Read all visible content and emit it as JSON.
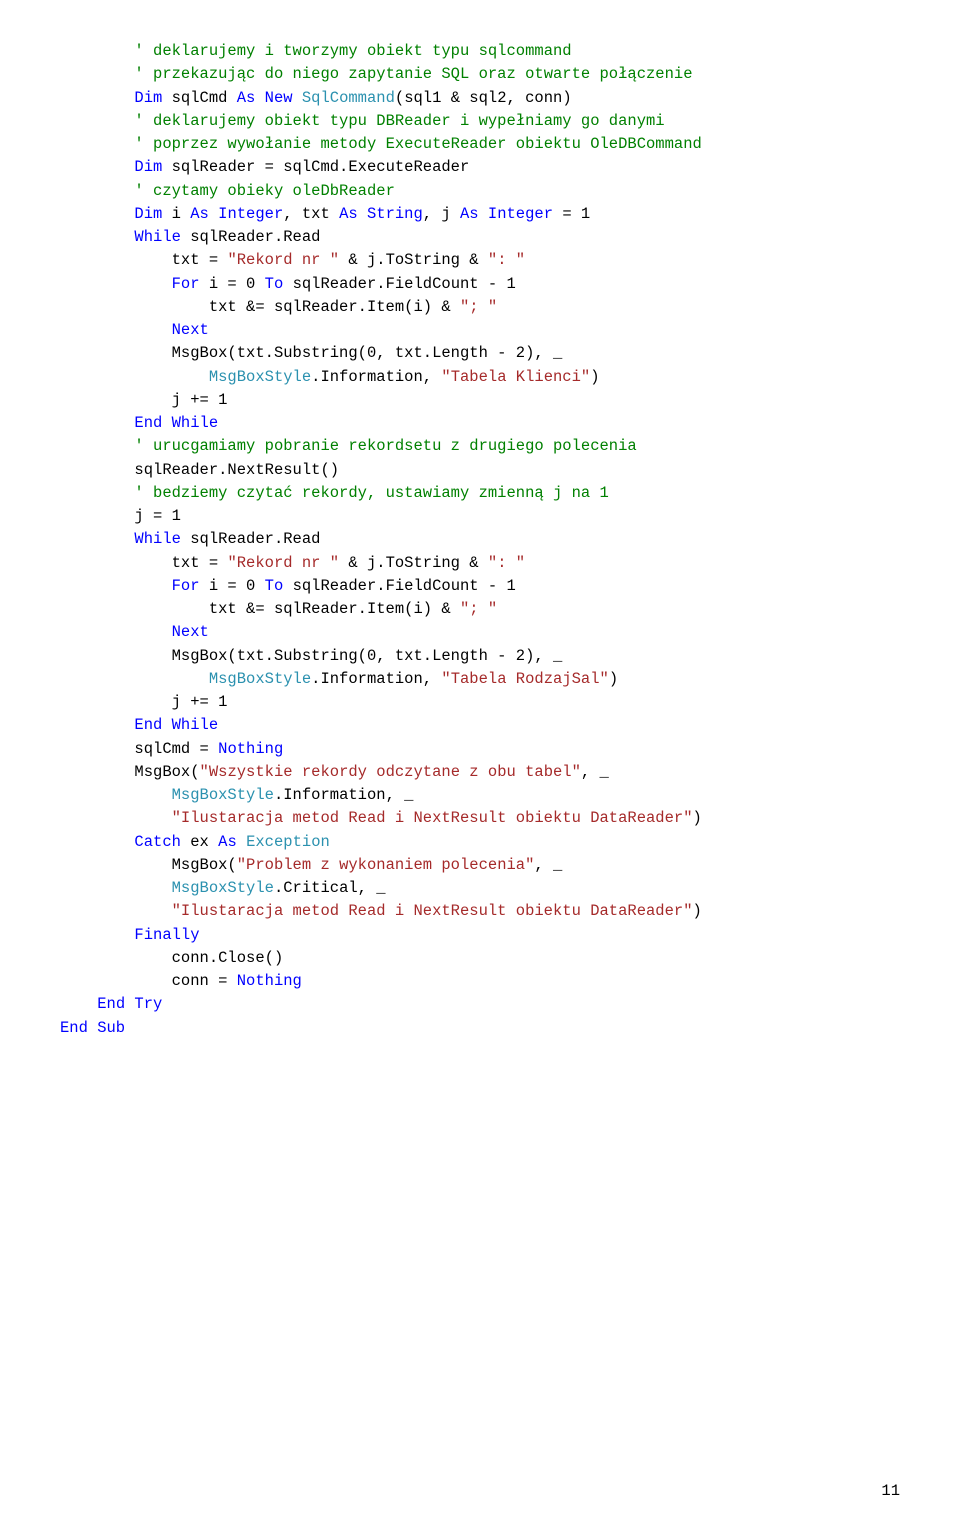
{
  "lines": [
    {
      "i": 2,
      "t": [
        {
          "c": "green",
          "s": "' deklarujemy i tworzymy obiekt typu sqlcommand"
        }
      ]
    },
    {
      "i": 2,
      "t": [
        {
          "c": "green",
          "s": "' przekazując do niego zapytanie SQL oraz otwarte połączenie"
        }
      ]
    },
    {
      "i": 2,
      "t": [
        {
          "c": "blue",
          "s": "Dim"
        },
        {
          "c": "black",
          "s": " sqlCmd "
        },
        {
          "c": "blue",
          "s": "As New"
        },
        {
          "c": "black",
          "s": " "
        },
        {
          "c": "teal",
          "s": "SqlCommand"
        },
        {
          "c": "black",
          "s": "(sql1 & sql2, conn)"
        }
      ]
    },
    {
      "i": 2,
      "t": [
        {
          "c": "green",
          "s": "' deklarujemy obiekt typu DBReader i wypełniamy go danymi"
        }
      ]
    },
    {
      "i": 2,
      "t": [
        {
          "c": "green",
          "s": "' poprzez wywołanie metody ExecuteReader obiektu OleDBCommand"
        }
      ]
    },
    {
      "i": 2,
      "t": [
        {
          "c": "blue",
          "s": "Dim"
        },
        {
          "c": "black",
          "s": " sqlReader = sqlCmd.ExecuteReader"
        }
      ]
    },
    {
      "i": 2,
      "t": [
        {
          "c": "green",
          "s": "' czytamy obieky oleDbReader"
        }
      ]
    },
    {
      "i": 2,
      "t": [
        {
          "c": "blue",
          "s": "Dim"
        },
        {
          "c": "black",
          "s": " i "
        },
        {
          "c": "blue",
          "s": "As Integer"
        },
        {
          "c": "black",
          "s": ", txt "
        },
        {
          "c": "blue",
          "s": "As String"
        },
        {
          "c": "black",
          "s": ", j "
        },
        {
          "c": "blue",
          "s": "As Integer"
        },
        {
          "c": "black",
          "s": " = 1"
        }
      ]
    },
    {
      "i": 2,
      "t": [
        {
          "c": "blue",
          "s": "While"
        },
        {
          "c": "black",
          "s": " sqlReader.Read"
        }
      ]
    },
    {
      "i": 3,
      "t": [
        {
          "c": "black",
          "s": "txt = "
        },
        {
          "c": "brown",
          "s": "\"Rekord nr \""
        },
        {
          "c": "black",
          "s": " & j.ToString & "
        },
        {
          "c": "brown",
          "s": "\": \""
        }
      ]
    },
    {
      "i": 3,
      "t": [
        {
          "c": "blue",
          "s": "For"
        },
        {
          "c": "black",
          "s": " i = 0 "
        },
        {
          "c": "blue",
          "s": "To"
        },
        {
          "c": "black",
          "s": " sqlReader.FieldCount - 1"
        }
      ]
    },
    {
      "i": 4,
      "t": [
        {
          "c": "black",
          "s": "txt &= sqlReader.Item(i) & "
        },
        {
          "c": "brown",
          "s": "\"; \""
        }
      ]
    },
    {
      "i": 3,
      "t": [
        {
          "c": "blue",
          "s": "Next"
        }
      ]
    },
    {
      "i": 3,
      "t": [
        {
          "c": "black",
          "s": "MsgBox(txt.Substring(0, txt.Length - 2), _"
        }
      ]
    },
    {
      "i": 4,
      "t": [
        {
          "c": "teal",
          "s": "MsgBoxStyle"
        },
        {
          "c": "black",
          "s": ".Information, "
        },
        {
          "c": "brown",
          "s": "\"Tabela Klienci\""
        },
        {
          "c": "black",
          "s": ")"
        }
      ]
    },
    {
      "i": 3,
      "t": [
        {
          "c": "black",
          "s": "j += 1"
        }
      ]
    },
    {
      "i": 2,
      "t": [
        {
          "c": "blue",
          "s": "End While"
        }
      ]
    },
    {
      "i": 2,
      "t": [
        {
          "c": "green",
          "s": "' urucgamiamy pobranie rekordsetu z drugiego polecenia"
        }
      ]
    },
    {
      "i": 2,
      "t": [
        {
          "c": "black",
          "s": "sqlReader.NextResult()"
        }
      ]
    },
    {
      "i": 2,
      "t": [
        {
          "c": "green",
          "s": "' bedziemy czytać rekordy, ustawiamy zmienną j na 1"
        }
      ]
    },
    {
      "i": 2,
      "t": [
        {
          "c": "black",
          "s": "j = 1"
        }
      ]
    },
    {
      "i": 2,
      "t": [
        {
          "c": "blue",
          "s": "While"
        },
        {
          "c": "black",
          "s": " sqlReader.Read"
        }
      ]
    },
    {
      "i": 3,
      "t": [
        {
          "c": "black",
          "s": "txt = "
        },
        {
          "c": "brown",
          "s": "\"Rekord nr \""
        },
        {
          "c": "black",
          "s": " & j.ToString & "
        },
        {
          "c": "brown",
          "s": "\": \""
        }
      ]
    },
    {
      "i": 3,
      "t": [
        {
          "c": "blue",
          "s": "For"
        },
        {
          "c": "black",
          "s": " i = 0 "
        },
        {
          "c": "blue",
          "s": "To"
        },
        {
          "c": "black",
          "s": " sqlReader.FieldCount - 1"
        }
      ]
    },
    {
      "i": 4,
      "t": [
        {
          "c": "black",
          "s": "txt &= sqlReader.Item(i) & "
        },
        {
          "c": "brown",
          "s": "\"; \""
        }
      ]
    },
    {
      "i": 3,
      "t": [
        {
          "c": "blue",
          "s": "Next"
        }
      ]
    },
    {
      "i": 3,
      "t": [
        {
          "c": "black",
          "s": "MsgBox(txt.Substring(0, txt.Length - 2), _"
        }
      ]
    },
    {
      "i": 4,
      "t": [
        {
          "c": "teal",
          "s": "MsgBoxStyle"
        },
        {
          "c": "black",
          "s": ".Information, "
        },
        {
          "c": "brown",
          "s": "\"Tabela RodzajSal\""
        },
        {
          "c": "black",
          "s": ")"
        }
      ]
    },
    {
      "i": 3,
      "t": [
        {
          "c": "black",
          "s": "j += 1"
        }
      ]
    },
    {
      "i": 2,
      "t": [
        {
          "c": "blue",
          "s": "End While"
        }
      ]
    },
    {
      "i": 2,
      "t": [
        {
          "c": "black",
          "s": "sqlCmd = "
        },
        {
          "c": "blue",
          "s": "Nothing"
        }
      ]
    },
    {
      "i": 2,
      "t": [
        {
          "c": "black",
          "s": "MsgBox("
        },
        {
          "c": "brown",
          "s": "\"Wszystkie rekordy odczytane z obu tabel\""
        },
        {
          "c": "black",
          "s": ", _"
        }
      ]
    },
    {
      "i": 3,
      "t": [
        {
          "c": "teal",
          "s": "MsgBoxStyle"
        },
        {
          "c": "black",
          "s": ".Information, _"
        }
      ]
    },
    {
      "i": 3,
      "t": [
        {
          "c": "brown",
          "s": "\"Ilustaracja metod Read i NextResult obiektu DataReader\""
        },
        {
          "c": "black",
          "s": ")"
        }
      ]
    },
    {
      "i": 2,
      "t": [
        {
          "c": "blue",
          "s": "Catch"
        },
        {
          "c": "black",
          "s": " ex "
        },
        {
          "c": "blue",
          "s": "As"
        },
        {
          "c": "black",
          "s": " "
        },
        {
          "c": "teal",
          "s": "Exception"
        }
      ]
    },
    {
      "i": 3,
      "t": [
        {
          "c": "black",
          "s": "MsgBox("
        },
        {
          "c": "brown",
          "s": "\"Problem z wykonaniem polecenia\""
        },
        {
          "c": "black",
          "s": ", _"
        }
      ]
    },
    {
      "i": 3,
      "t": [
        {
          "c": "teal",
          "s": "MsgBoxStyle"
        },
        {
          "c": "black",
          "s": ".Critical, _"
        }
      ]
    },
    {
      "i": 3,
      "t": [
        {
          "c": "brown",
          "s": "\"Ilustaracja metod Read i NextResult obiektu DataReader\""
        },
        {
          "c": "black",
          "s": ")"
        }
      ]
    },
    {
      "i": 2,
      "t": [
        {
          "c": "blue",
          "s": "Finally"
        }
      ]
    },
    {
      "i": 3,
      "t": [
        {
          "c": "black",
          "s": "conn.Close()"
        }
      ]
    },
    {
      "i": 3,
      "t": [
        {
          "c": "black",
          "s": "conn = "
        },
        {
          "c": "blue",
          "s": "Nothing"
        }
      ]
    },
    {
      "i": 1,
      "t": [
        {
          "c": "blue",
          "s": "End Try"
        }
      ]
    },
    {
      "i": 0,
      "t": [
        {
          "c": "blue",
          "s": "End Sub"
        }
      ]
    }
  ],
  "indent_unit": "    ",
  "page_number": "11"
}
